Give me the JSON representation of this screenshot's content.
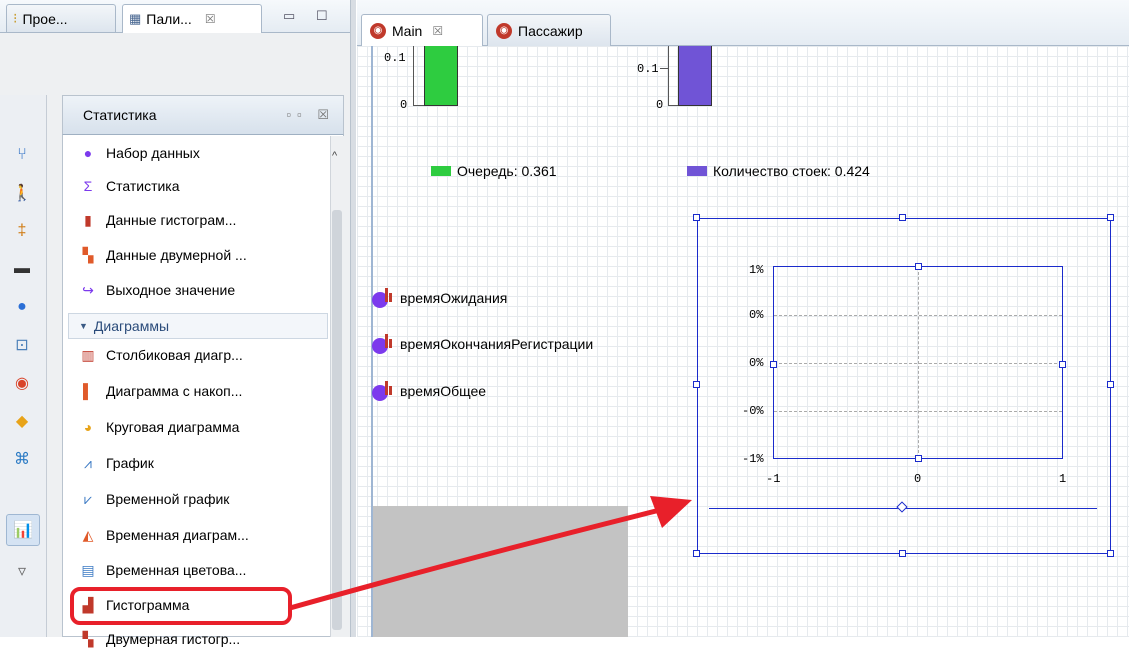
{
  "left_tabs": [
    {
      "label": "Прое...",
      "icon": "projects-icon"
    },
    {
      "label": "Пали...",
      "icon": "palette-icon",
      "close": "☒"
    }
  ],
  "window_controls": {
    "minimize": "▭",
    "maximize": "☐"
  },
  "palette": {
    "title": "Статистика",
    "header_icons": "▫▫ ☒",
    "items": [
      {
        "label": "Набор данных",
        "icon": "dataset-icon"
      },
      {
        "label": "Статистика",
        "icon": "statistics-icon"
      },
      {
        "label": "Данные гистограм...",
        "icon": "histogram-data-icon"
      },
      {
        "label": "Данные двумерной ...",
        "icon": "2d-histogram-data-icon"
      },
      {
        "label": "Выходное значение",
        "icon": "output-value-icon"
      }
    ],
    "section": {
      "label": "Диаграммы"
    },
    "chart_items": [
      {
        "label": "Столбиковая диагр...",
        "icon": "bar-chart-icon"
      },
      {
        "label": "Диаграмма с накоп...",
        "icon": "stacked-chart-icon"
      },
      {
        "label": "Круговая диаграмма",
        "icon": "pie-chart-icon"
      },
      {
        "label": "График",
        "icon": "plot-icon"
      },
      {
        "label": "Временной график",
        "icon": "time-plot-icon"
      },
      {
        "label": "Временная диаграм...",
        "icon": "time-stack-chart-icon"
      },
      {
        "label": "Временная цветова...",
        "icon": "time-color-chart-icon"
      },
      {
        "label": "Гистограмма",
        "icon": "histogram-icon"
      },
      {
        "label": "Двумерная гистогр...",
        "icon": "2d-histogram-icon"
      }
    ]
  },
  "category_buttons": [
    "process-icon",
    "pedestrian-icon",
    "rail-icon",
    "road-icon",
    "fluid-icon",
    "network-icon",
    "agent-icon",
    "presentation-icon",
    "connectivity-icon",
    "analysis-icon",
    "more-icon"
  ],
  "editor_tabs": [
    {
      "label": "Main",
      "close": "☒",
      "icon": "agent-type-icon"
    },
    {
      "label": "Пассажир",
      "icon": "agent-type-icon"
    }
  ],
  "canvas": {
    "bar1_axis": {
      "top": "0.1",
      "zero": "0"
    },
    "bar2_axis": {
      "top": "0.1",
      "zero": "0"
    },
    "legend": [
      {
        "label": "Очередь: 0.361",
        "color": "#2ecc40"
      },
      {
        "label": "Количество стоек: 0.424",
        "color": "#7054d6"
      }
    ],
    "datasets": [
      "времяОжидания",
      "времяОкончанияРегистрации",
      "времяОбщее"
    ],
    "histogram": {
      "y_ticks": [
        "1%",
        "0%",
        "0%",
        "-0%",
        "-1%"
      ],
      "x_ticks": [
        "-1",
        "0",
        "1"
      ]
    }
  },
  "colors": {
    "accent": "#1a2bcc",
    "callout": "#e8202a"
  }
}
